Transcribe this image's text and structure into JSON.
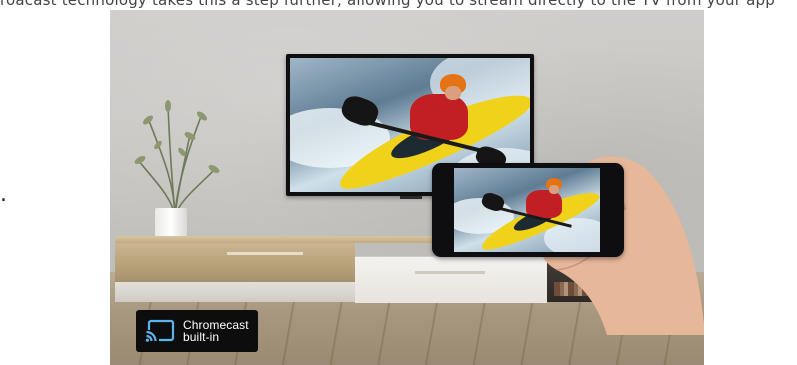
{
  "top_caption": "roacast technology takes this a step further, allowing you to stream directly to the TV from your app",
  "bullet": ".",
  "badge": {
    "line1": "Chromecast",
    "line2": "built-in"
  },
  "icons": {
    "cast": "chromecast-icon"
  },
  "colors": {
    "badge_bg": "#0d0d0d",
    "kayak_yellow": "#f0d21a",
    "helmet_orange": "#e57316",
    "jacket_red": "#c21f24"
  }
}
